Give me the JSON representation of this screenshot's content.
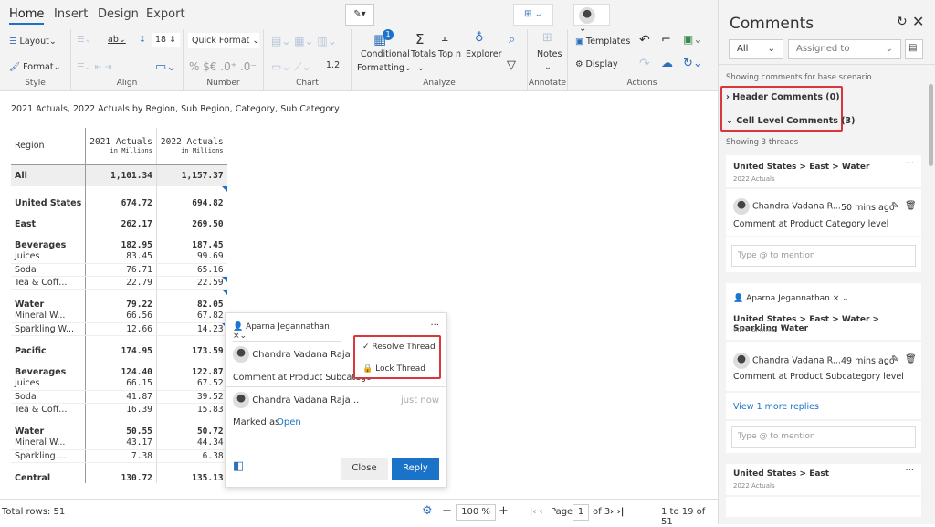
{
  "ribbon": {
    "tabs": [
      "Home",
      "Insert",
      "Design",
      "Export"
    ],
    "style": {
      "label": "Style",
      "layout": "Layout",
      "format": "Format"
    },
    "align": {
      "label": "Align",
      "font_size": "18"
    },
    "number": {
      "label": "Number",
      "quick_format": "Quick Format",
      "symbols": "% $€ .0⁺ .0⁻"
    },
    "chart": {
      "label": "Chart",
      "decimal": "1.2"
    },
    "analyze": {
      "label": "Analyze",
      "conditional": "Conditional",
      "formatting": "Formatting",
      "badge": "1",
      "totals": "Totals",
      "topn": "Top n",
      "explorer": "Explorer"
    },
    "annotate": {
      "label": "Annotate",
      "notes": "Notes"
    },
    "actions": {
      "label": "Actions",
      "templates": "Templates",
      "display": "Display"
    }
  },
  "subtitle": "2021 Actuals, 2022 Actuals by Region, Sub Region, Category, Sub Category",
  "grid": {
    "headers": {
      "region": "Region",
      "c2": "2021 Actuals",
      "c3": "2022 Actuals",
      "unit": "in Millions"
    },
    "rows": [
      {
        "l": "All",
        "a": "1,101.34",
        "b": "1,157.37"
      },
      {
        "l": "United States",
        "a": "674.72",
        "b": "694.82"
      },
      {
        "l": "East",
        "a": "262.17",
        "b": "269.50"
      },
      {
        "l": "Beverages",
        "a": "182.95",
        "b": "187.45"
      },
      {
        "l": "Juices",
        "a": "83.45",
        "b": "99.69"
      },
      {
        "l": "Soda",
        "a": "76.71",
        "b": "65.16"
      },
      {
        "l": "Tea & Coff...",
        "a": "22.79",
        "b": "22.59"
      },
      {
        "l": "Water",
        "a": "79.22",
        "b": "82.05"
      },
      {
        "l": "Mineral W...",
        "a": "66.56",
        "b": "67.82"
      },
      {
        "l": "Sparkling W...",
        "a": "12.66",
        "b": "14.23"
      },
      {
        "l": "Pacific",
        "a": "174.95",
        "b": "173.59"
      },
      {
        "l": "Beverages",
        "a": "124.40",
        "b": "122.87"
      },
      {
        "l": "Juices",
        "a": "66.15",
        "b": "67.52"
      },
      {
        "l": "Soda",
        "a": "41.87",
        "b": "39.52"
      },
      {
        "l": "Tea & Coff...",
        "a": "16.39",
        "b": "15.83"
      },
      {
        "l": "Water",
        "a": "50.55",
        "b": "50.72"
      },
      {
        "l": "Mineral W...",
        "a": "43.17",
        "b": "44.34"
      },
      {
        "l": "Sparkling ...",
        "a": "7.38",
        "b": "6.38"
      },
      {
        "l": "Central",
        "a": "130.72",
        "b": "135.13"
      }
    ]
  },
  "popup": {
    "assignee": "Aparna Jegannathan",
    "author": "Chandra Vadana Raja...",
    "comment": "Comment at Product Subcatego",
    "time": "just now",
    "marked": "Marked as",
    "status": "Open",
    "close": "Close",
    "reply": "Reply",
    "menu": {
      "resolve": "Resolve Thread",
      "lock": "Lock Thread"
    }
  },
  "status": {
    "total": "Total rows: 51",
    "zoom": "100 %",
    "page_label": "Page",
    "page": "1",
    "of": "of 3",
    "range": "1 to 19 of 51"
  },
  "panel": {
    "title": "Comments",
    "filter": "All",
    "assigned": "Assigned to",
    "scenario": "Showing comments for base scenario",
    "header_comments": "Header Comments (0)",
    "cell_comments": "Cell Level Comments (3)",
    "threads": "Showing 3 threads",
    "mention": "Type @ to mention",
    "cards": [
      {
        "path": "United States > East > Water",
        "measure": "2022 Actuals",
        "author": "Chandra Vadana R...",
        "time": "50 mins ago",
        "text": "Comment at Product Category level"
      },
      {
        "assignee": "Aparna Jegannathan",
        "path": "United States > East > Water > Sparkling Water",
        "measure": "2022 Actuals",
        "author": "Chandra Vadana R...",
        "time": "49 mins ago",
        "text": "Comment at Product Subcategory level",
        "more": "View 1 more replies"
      },
      {
        "path": "United States > East",
        "measure": "2022 Actuals"
      }
    ]
  }
}
